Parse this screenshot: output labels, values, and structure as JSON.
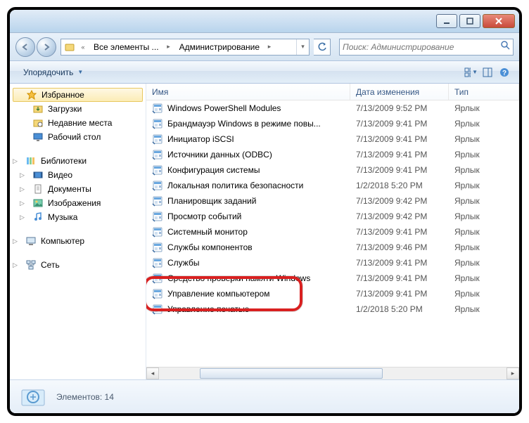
{
  "breadcrumb": {
    "prefix": "«",
    "seg1": "Все элементы ...",
    "seg2": "Администрирование"
  },
  "search": {
    "placeholder": "Поиск: Администрирование"
  },
  "toolbar": {
    "organize": "Упорядочить"
  },
  "columns": {
    "name": "Имя",
    "date": "Дата изменения",
    "type": "Тип"
  },
  "sidebar": {
    "favorites": "Избранное",
    "fav_items": [
      "Загрузки",
      "Недавние места",
      "Рабочий стол"
    ],
    "libraries": "Библиотеки",
    "lib_items": [
      "Видео",
      "Документы",
      "Изображения",
      "Музыка"
    ],
    "computer": "Компьютер",
    "network": "Сеть"
  },
  "type_label": "Ярлык",
  "rows": [
    {
      "name": "Windows PowerShell Modules",
      "date": "7/13/2009 9:52 PM"
    },
    {
      "name": "Брандмауэр Windows в режиме повы...",
      "date": "7/13/2009 9:41 PM"
    },
    {
      "name": "Инициатор iSCSI",
      "date": "7/13/2009 9:41 PM"
    },
    {
      "name": "Источники данных (ODBC)",
      "date": "7/13/2009 9:41 PM"
    },
    {
      "name": "Конфигурация системы",
      "date": "7/13/2009 9:41 PM"
    },
    {
      "name": "Локальная политика безопасности",
      "date": "1/2/2018 5:20 PM"
    },
    {
      "name": "Планировщик заданий",
      "date": "7/13/2009 9:42 PM"
    },
    {
      "name": "Просмотр событий",
      "date": "7/13/2009 9:42 PM"
    },
    {
      "name": "Системный монитор",
      "date": "7/13/2009 9:41 PM"
    },
    {
      "name": "Службы компонентов",
      "date": "7/13/2009 9:46 PM"
    },
    {
      "name": "Службы",
      "date": "7/13/2009 9:41 PM"
    },
    {
      "name": "Средство проверки памяти Windows",
      "date": "7/13/2009 9:41 PM"
    },
    {
      "name": "Управление компьютером",
      "date": "7/13/2009 9:41 PM"
    },
    {
      "name": "Управление печатью",
      "date": "1/2/2018 5:20 PM"
    }
  ],
  "status": {
    "text": "Элементов: 14"
  }
}
